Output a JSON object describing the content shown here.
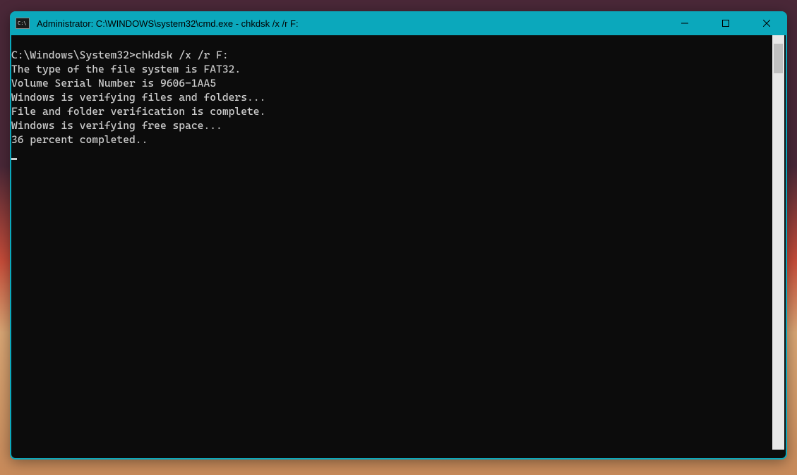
{
  "window": {
    "title": "Administrator: C:\\WINDOWS\\system32\\cmd.exe - chkdsk  /x /r F:",
    "app_icon_text": "C:\\"
  },
  "terminal": {
    "prompt": "C:\\Windows\\System32>",
    "command": "chkdsk /x /r F:",
    "lines": [
      "The type of the file system is FAT32.",
      "Volume Serial Number is 9606-1AA5",
      "Windows is verifying files and folders...",
      "File and folder verification is complete.",
      "Windows is verifying free space...",
      "36 percent completed.."
    ]
  }
}
